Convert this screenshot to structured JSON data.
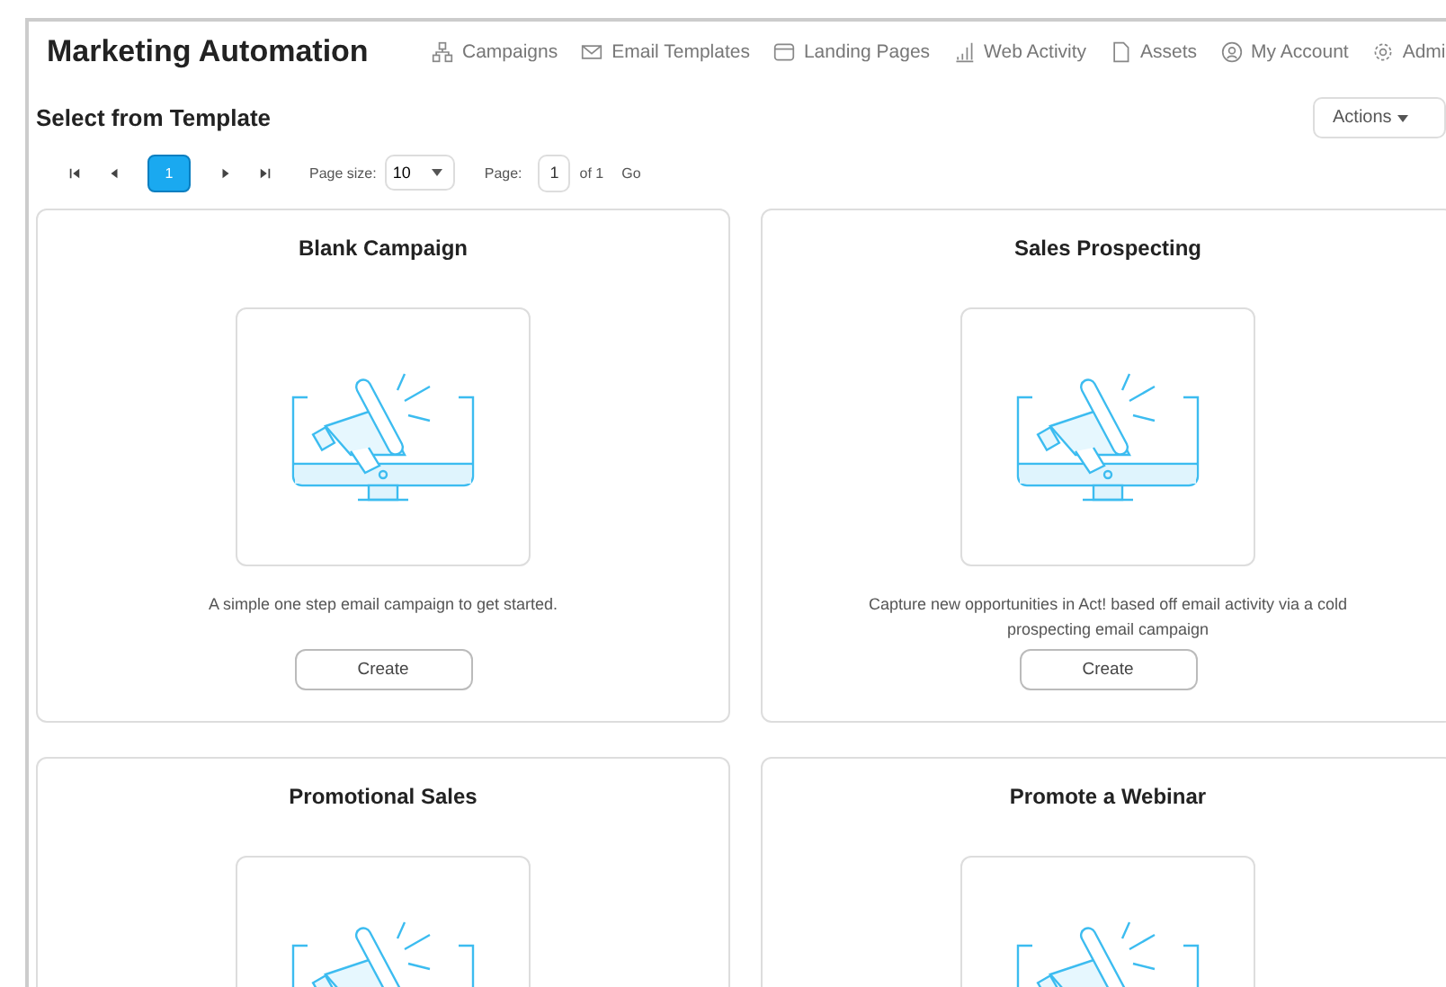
{
  "app_title": "Marketing Automation",
  "nav": [
    {
      "label": "Campaigns"
    },
    {
      "label": "Email Templates"
    },
    {
      "label": "Landing Pages"
    },
    {
      "label": "Web Activity"
    },
    {
      "label": "Assets"
    },
    {
      "label": "My Account"
    },
    {
      "label": "Admi"
    }
  ],
  "section_title": "Select from Template",
  "actions_button": "Actions",
  "pager": {
    "current_page": "1",
    "page_size_label": "Page size:",
    "page_size": "10",
    "page_label": "Page:",
    "page_value": "1",
    "of_label": "of 1",
    "go": "Go"
  },
  "templates": [
    {
      "title": "Blank Campaign",
      "description": "A simple one step email campaign to get started.",
      "button": "Create"
    },
    {
      "title": "Sales Prospecting",
      "description": "Capture new opportunities in Act! based off email activity via a cold prospecting email campaign",
      "button": "Create"
    },
    {
      "title": "Promotional Sales"
    },
    {
      "title": "Promote a Webinar"
    }
  ]
}
